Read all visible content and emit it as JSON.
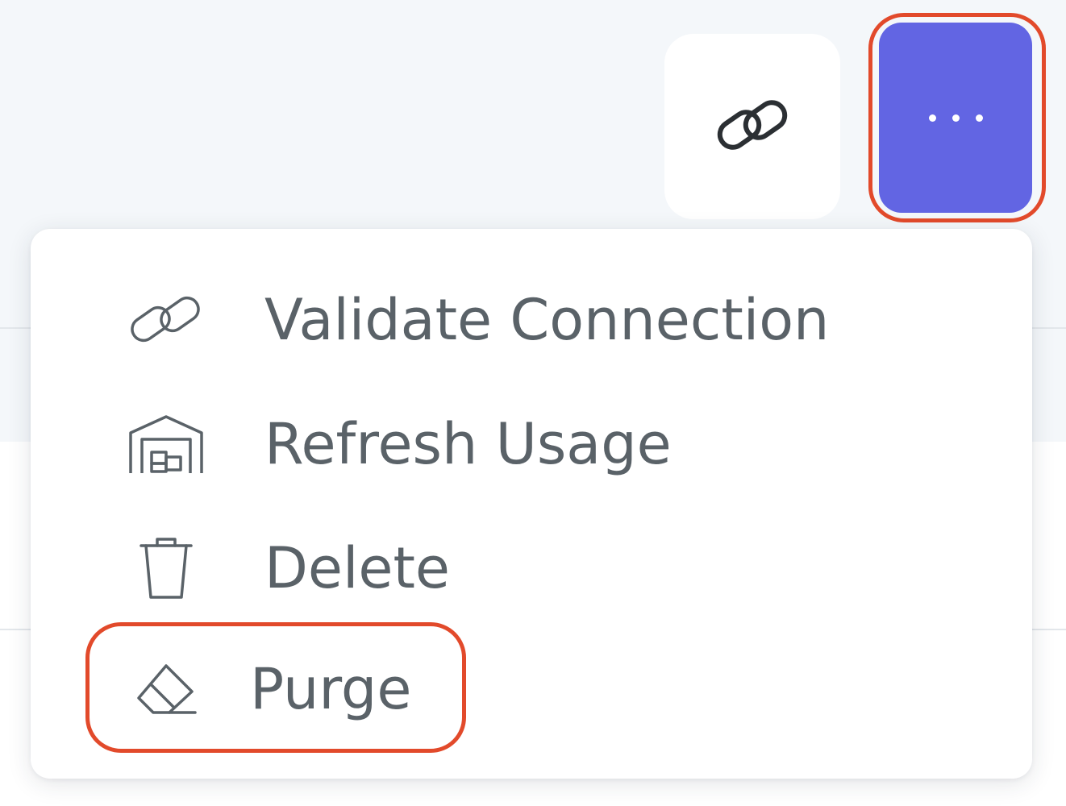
{
  "toolbar": {
    "link_button_icon": "link-icon",
    "more_button_icon": "ellipsis-icon",
    "accent_color": "#6265e3",
    "highlight_color": "#e24a2b"
  },
  "menu": {
    "items": [
      {
        "label": "Validate Connection",
        "icon": "link-icon"
      },
      {
        "label": "Refresh Usage",
        "icon": "warehouse-icon"
      },
      {
        "label": "Delete",
        "icon": "trash-icon"
      },
      {
        "label": "Purge",
        "icon": "eraser-icon"
      }
    ]
  }
}
